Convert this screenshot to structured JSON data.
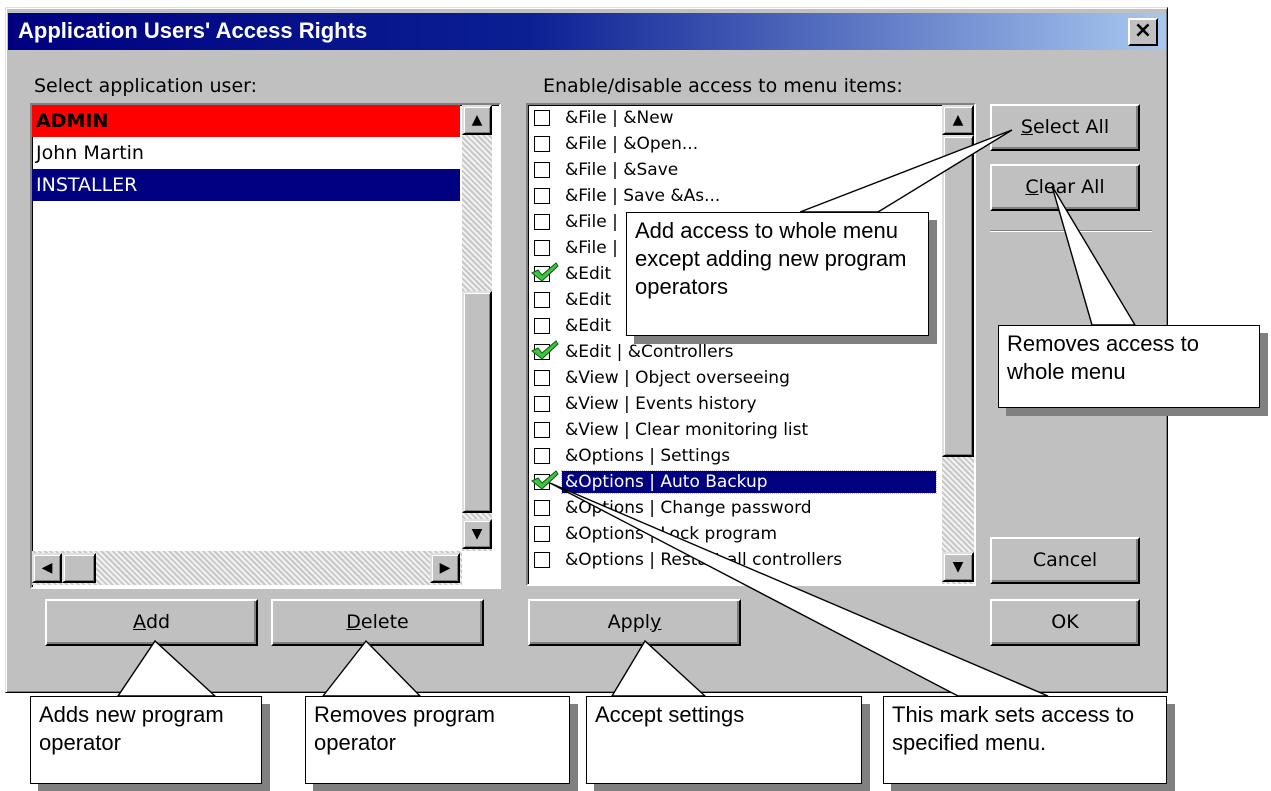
{
  "window": {
    "title": "Application Users' Access Rights",
    "close_glyph": "×"
  },
  "users": {
    "label": "Select application user:",
    "items": [
      {
        "name": "ADMIN",
        "style": "red"
      },
      {
        "name": "John Martin",
        "style": "normal"
      },
      {
        "name": "INSTALLER",
        "style": "selected"
      }
    ]
  },
  "menu": {
    "label": "Enable/disable access to menu items:",
    "items": [
      {
        "label": "&File | &New",
        "checked": false
      },
      {
        "label": "&File | &Open...",
        "checked": false
      },
      {
        "label": "&File | &Save",
        "checked": false
      },
      {
        "label": "&File | Save &As...",
        "checked": false
      },
      {
        "label": "&File |",
        "checked": false
      },
      {
        "label": "&File |",
        "checked": false
      },
      {
        "label": "&Edit",
        "checked": true
      },
      {
        "label": "&Edit",
        "checked": false
      },
      {
        "label": "&Edit",
        "checked": false
      },
      {
        "label": "&Edit | &Controllers",
        "checked": true
      },
      {
        "label": "&View | Object overseeing",
        "checked": false
      },
      {
        "label": "&View | Events history",
        "checked": false
      },
      {
        "label": "&View | Clear monitoring list",
        "checked": false
      },
      {
        "label": "&Options | Settings",
        "checked": false
      },
      {
        "label": "&Options | Auto Backup",
        "checked": true,
        "selected": true
      },
      {
        "label": "&Options | Change password",
        "checked": false
      },
      {
        "label": "&Options | Lock program",
        "checked": false
      },
      {
        "label": "&Options | Restart all controllers",
        "checked": false
      }
    ]
  },
  "buttons": {
    "select_all": {
      "pre": "",
      "mnemonic": "S",
      "post": "elect All"
    },
    "clear_all": {
      "pre": "",
      "mnemonic": "C",
      "post": "lear All"
    },
    "cancel": "Cancel",
    "ok": "OK",
    "add": {
      "pre": "",
      "mnemonic": "A",
      "post": "dd"
    },
    "delete": {
      "pre": "",
      "mnemonic": "D",
      "post": "elete"
    },
    "apply": {
      "pre": "Appl",
      "mnemonic": "y",
      "post": ""
    }
  },
  "callouts": {
    "select_all": "Add access to whole menu except  adding new program operators",
    "clear_all": "Removes access to whole menu",
    "add": "Adds new program operator",
    "delete": "Removes program operator",
    "apply": "Accept  settings",
    "mark": "This mark sets access to specified menu."
  },
  "colors": {
    "title_bar": "#000080",
    "admin_row": "#ff0000",
    "selection": "#000080",
    "dialog_face": "#c0c0c0",
    "check": "#3ec43e"
  }
}
